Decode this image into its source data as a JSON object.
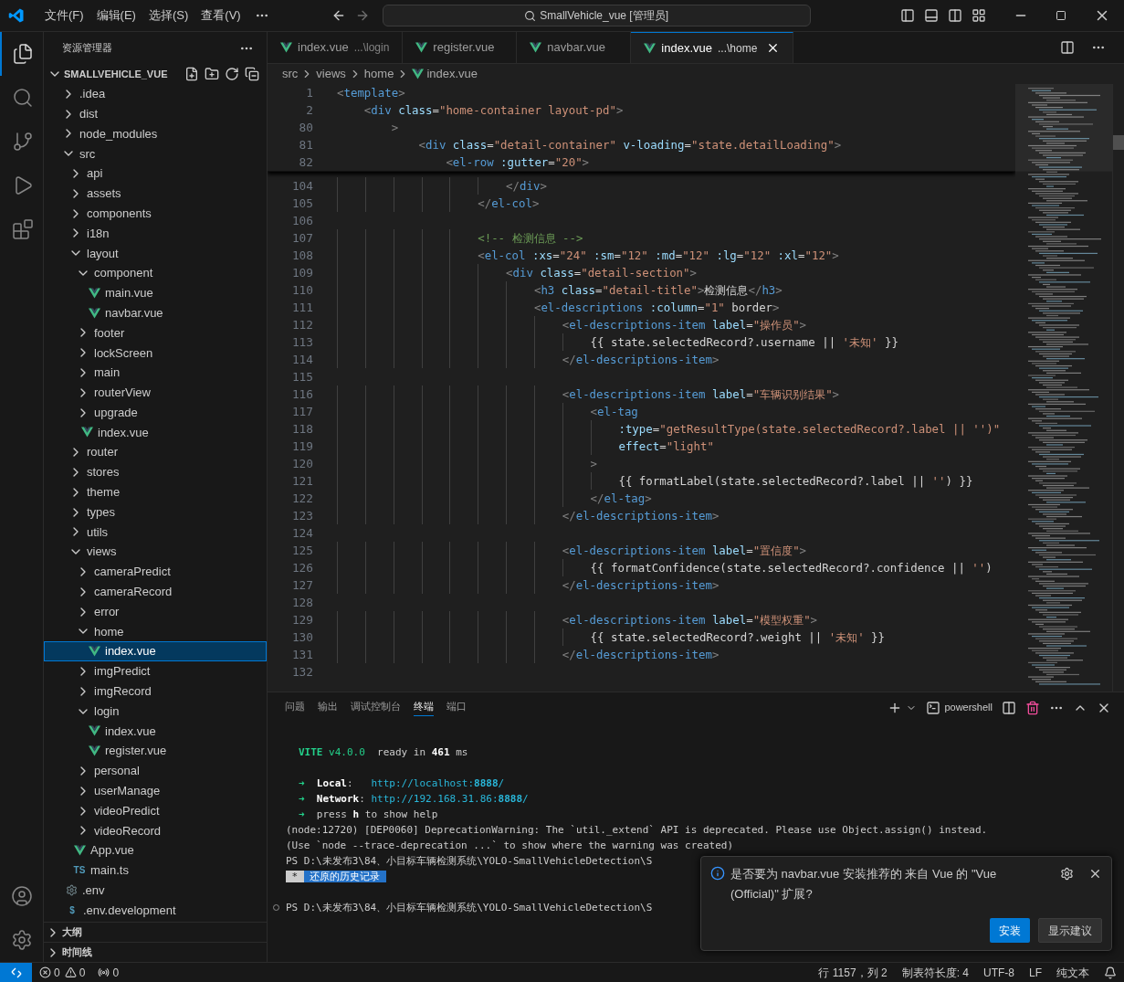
{
  "title_bar": {
    "menus": [
      "文件(F)",
      "编辑(E)",
      "选择(S)",
      "查看(V)"
    ],
    "command_center": "SmallVehicle_vue [管理员]"
  },
  "activity_bar": [
    {
      "kind": "files",
      "selected": true
    },
    {
      "kind": "search",
      "selected": false
    },
    {
      "kind": "source-control",
      "selected": false
    },
    {
      "kind": "run",
      "selected": false
    },
    {
      "kind": "extensions",
      "selected": false
    }
  ],
  "sidebar": {
    "title": "资源管理器",
    "project": "SMALLVEHICLE_VUE",
    "tree": [
      {
        "label": ".idea",
        "kind": "folder",
        "expanded": false,
        "selected": false
      },
      {
        "label": "dist",
        "kind": "folder",
        "expanded": false,
        "selected": false
      },
      {
        "label": "node_modules",
        "kind": "folder",
        "expanded": false,
        "selected": false
      },
      {
        "label": "src",
        "kind": "folder",
        "expanded": true,
        "selected": false,
        "children": [
          {
            "label": "api",
            "kind": "folder",
            "expanded": false,
            "selected": false
          },
          {
            "label": "assets",
            "kind": "folder",
            "expanded": false,
            "selected": false
          },
          {
            "label": "components",
            "kind": "folder",
            "expanded": false,
            "selected": false
          },
          {
            "label": "i18n",
            "kind": "folder",
            "expanded": false,
            "selected": false
          },
          {
            "label": "layout",
            "kind": "folder",
            "expanded": true,
            "selected": false,
            "children": [
              {
                "label": "component",
                "kind": "folder",
                "expanded": true,
                "selected": false,
                "children": [
                  {
                    "label": "main.vue",
                    "kind": "vue",
                    "selected": false
                  },
                  {
                    "label": "navbar.vue",
                    "kind": "vue",
                    "selected": false
                  }
                ]
              },
              {
                "label": "footer",
                "kind": "folder",
                "expanded": false,
                "selected": false
              },
              {
                "label": "lockScreen",
                "kind": "folder",
                "expanded": false,
                "selected": false
              },
              {
                "label": "main",
                "kind": "folder",
                "expanded": false,
                "selected": false
              },
              {
                "label": "routerView",
                "kind": "folder",
                "expanded": false,
                "selected": false
              },
              {
                "label": "upgrade",
                "kind": "folder",
                "expanded": false,
                "selected": false
              },
              {
                "label": "index.vue",
                "kind": "vue",
                "selected": false
              }
            ]
          },
          {
            "label": "router",
            "kind": "folder",
            "expanded": false,
            "selected": false
          },
          {
            "label": "stores",
            "kind": "folder",
            "expanded": false,
            "selected": false
          },
          {
            "label": "theme",
            "kind": "folder",
            "expanded": false,
            "selected": false
          },
          {
            "label": "types",
            "kind": "folder",
            "expanded": false,
            "selected": false
          },
          {
            "label": "utils",
            "kind": "folder",
            "expanded": false,
            "selected": false
          },
          {
            "label": "views",
            "kind": "folder",
            "expanded": true,
            "selected": false,
            "children": [
              {
                "label": "cameraPredict",
                "kind": "folder",
                "expanded": false,
                "selected": false
              },
              {
                "label": "cameraRecord",
                "kind": "folder",
                "expanded": false,
                "selected": false
              },
              {
                "label": "error",
                "kind": "folder",
                "expanded": false,
                "selected": false
              },
              {
                "label": "home",
                "kind": "folder",
                "expanded": true,
                "selected": false,
                "children": [
                  {
                    "label": "index.vue",
                    "kind": "vue",
                    "selected": true
                  }
                ]
              },
              {
                "label": "imgPredict",
                "kind": "folder",
                "expanded": false,
                "selected": false
              },
              {
                "label": "imgRecord",
                "kind": "folder",
                "expanded": false,
                "selected": false
              },
              {
                "label": "login",
                "kind": "folder",
                "expanded": true,
                "selected": false,
                "children": [
                  {
                    "label": "index.vue",
                    "kind": "vue",
                    "selected": false
                  },
                  {
                    "label": "register.vue",
                    "kind": "vue",
                    "selected": false
                  }
                ]
              },
              {
                "label": "personal",
                "kind": "folder",
                "expanded": false,
                "selected": false
              },
              {
                "label": "userManage",
                "kind": "folder",
                "expanded": false,
                "selected": false
              },
              {
                "label": "videoPredict",
                "kind": "folder",
                "expanded": false,
                "selected": false
              },
              {
                "label": "videoRecord",
                "kind": "folder",
                "expanded": false,
                "selected": false
              }
            ]
          },
          {
            "label": "App.vue",
            "kind": "vue",
            "selected": false
          },
          {
            "label": "main.ts",
            "kind": "badge",
            "badge": "TS",
            "selected": false
          }
        ]
      },
      {
        "label": ".env",
        "kind": "config",
        "selected": false
      },
      {
        "label": ".env.development",
        "kind": "badge",
        "badge": "$",
        "selected": false
      }
    ],
    "sections": [
      {
        "label": "大纲",
        "expanded": false
      },
      {
        "label": "时间线",
        "expanded": false
      }
    ]
  },
  "tabs": [
    {
      "name": "index.vue",
      "path": "...\\login",
      "selected": false
    },
    {
      "name": "register.vue",
      "selected": false
    },
    {
      "name": "navbar.vue",
      "selected": false
    },
    {
      "name": "index.vue",
      "path": "...\\home",
      "selected": true
    }
  ],
  "breadcrumb": [
    "src",
    "views",
    "home",
    "index.vue"
  ],
  "sticky_lines": [
    {
      "number": "1",
      "code": "<template>"
    },
    {
      "number": "2",
      "code": "    <div class=\"home-container layout-pd\">"
    },
    {
      "number": "80",
      "code": "        >"
    },
    {
      "number": "81",
      "code": "            <div class=\"detail-container\" v-loading=\"state.detailLoading\">"
    },
    {
      "number": "82",
      "code": "                <el-row :gutter=\"20\">"
    }
  ],
  "lines": [
    {
      "number": "104",
      "code": "                        </div>"
    },
    {
      "number": "105",
      "code": "                    </el-col>"
    },
    {
      "number": "106"
    },
    {
      "number": "107",
      "code": "                    <!-- 检测信息 -->"
    },
    {
      "number": "108",
      "code": "                    <el-col :xs=\"24\" :sm=\"12\" :md=\"12\" :lg=\"12\" :xl=\"12\">"
    },
    {
      "number": "109",
      "code": "                        <div class=\"detail-section\">"
    },
    {
      "number": "110",
      "code": "                            <h3 class=\"detail-title\">检测信息</h3>"
    },
    {
      "number": "111",
      "code": "                            <el-descriptions :column=\"1\" border>"
    },
    {
      "number": "112",
      "code": "                                <el-descriptions-item label=\"操作员\">"
    },
    {
      "number": "113",
      "code": "                                    {{ state.selectedRecord?.username || '未知' }}"
    },
    {
      "number": "114",
      "code": "                                </el-descriptions-item>"
    },
    {
      "number": "115"
    },
    {
      "number": "116",
      "code": "                                <el-descriptions-item label=\"车辆识别结果\">"
    },
    {
      "number": "117",
      "code": "                                    <el-tag"
    },
    {
      "number": "118",
      "code": "                                        :type=\"getResultType(state.selectedRecord?.label || '')\""
    },
    {
      "number": "119",
      "code": "                                        effect=\"light\""
    },
    {
      "number": "120",
      "code": "                                    >"
    },
    {
      "number": "121",
      "code": "                                        {{ formatLabel(state.selectedRecord?.label || '') }}"
    },
    {
      "number": "122",
      "code": "                                    </el-tag>"
    },
    {
      "number": "123",
      "code": "                                </el-descriptions-item>"
    },
    {
      "number": "124"
    },
    {
      "number": "125",
      "code": "                                <el-descriptions-item label=\"置信度\">"
    },
    {
      "number": "126",
      "code": "                                    {{ formatConfidence(state.selectedRecord?.confidence || '')"
    },
    {
      "number": "127",
      "code": "                                </el-descriptions-item>"
    },
    {
      "number": "128"
    },
    {
      "number": "129",
      "code": "                                <el-descriptions-item label=\"模型权重\">"
    },
    {
      "number": "130",
      "code": "                                    {{ state.selectedRecord?.weight || '未知' }}"
    },
    {
      "number": "131",
      "code": "                                </el-descriptions-item>"
    },
    {
      "number": "132"
    }
  ],
  "panel": {
    "tabs": [
      {
        "label": "问题",
        "selected": false
      },
      {
        "label": "输出",
        "selected": false
      },
      {
        "label": "调试控制台",
        "selected": false
      },
      {
        "label": "终端",
        "selected": true
      },
      {
        "label": "端口",
        "selected": false
      }
    ],
    "shell": "powershell",
    "terminal": [
      {
        "kind": "banner",
        "segments": [
          {
            "text": "VITE",
            "kind": "green-bold"
          },
          {
            "text": " v4.0.0",
            "kind": "green"
          },
          {
            "text": "  ready in ",
            "kind": "plain"
          },
          {
            "text": "461",
            "kind": "bold"
          },
          {
            "text": " ms",
            "kind": "plain"
          }
        ]
      },
      {
        "kind": "bullet",
        "segments": [
          {
            "text": "➜",
            "kind": "green"
          },
          {
            "text": "  Local",
            "kind": "bold"
          },
          {
            "text": ":   ",
            "kind": "plain"
          },
          {
            "text": "http://localhost:",
            "kind": "link"
          },
          {
            "text": "8888",
            "kind": "link-bold"
          },
          {
            "text": "/",
            "kind": "link"
          }
        ]
      },
      {
        "kind": "bullet",
        "segments": [
          {
            "text": "➜",
            "kind": "green"
          },
          {
            "text": "  Network",
            "kind": "bold"
          },
          {
            "text": ": ",
            "kind": "plain"
          },
          {
            "text": "http://192.168.31.86:",
            "kind": "link"
          },
          {
            "text": "8888",
            "kind": "link-bold"
          },
          {
            "text": "/",
            "kind": "link"
          }
        ]
      },
      {
        "kind": "bullet",
        "segments": [
          {
            "text": "➜",
            "kind": "green"
          },
          {
            "text": "  press ",
            "kind": "plain"
          },
          {
            "text": "h",
            "kind": "bold"
          },
          {
            "text": " to show help",
            "kind": "plain"
          }
        ]
      },
      {
        "kind": "plain",
        "segments": [
          {
            "text": "(node:12720) [DEP0060] DeprecationWarning: The `util._extend` API is deprecated. Please use Object.assign() instead.",
            "kind": "plain"
          }
        ]
      },
      {
        "kind": "plain",
        "segments": [
          {
            "text": "(Use `node --trace-deprecation ...` to show where the warning was created)",
            "kind": "plain"
          }
        ]
      },
      {
        "kind": "plain",
        "segments": [
          {
            "text": "PS D:\\未发布3\\84、小目标车辆检测系统\\YOLO-SmallVehicleDetection\\S",
            "kind": "plain"
          }
        ]
      },
      {
        "kind": "history",
        "segments": [
          {
            "text": " * ",
            "kind": "chip"
          },
          {
            "text": " 还原的历史记录 ",
            "kind": "selection"
          }
        ]
      },
      {
        "kind": "prompt",
        "segments": [
          {
            "text": "PS D:\\未发布3\\84、小目标车辆检测系统\\YOLO-SmallVehicleDetection\\S",
            "kind": "plain"
          }
        ]
      }
    ]
  },
  "notification": {
    "message": "是否要为 navbar.vue 安装推荐的 来自 Vue 的 \"Vue (Official)\" 扩展?",
    "buttons": [
      {
        "label": "安装",
        "kind": "primary"
      },
      {
        "label": "显示建议",
        "kind": "secondary"
      }
    ]
  },
  "status_bar": {
    "errors": "0",
    "warnings": "0",
    "ports": "0",
    "items": [
      "行 1157，列 2",
      "制表符长度: 4",
      "UTF-8",
      "LF",
      "纯文本"
    ]
  }
}
